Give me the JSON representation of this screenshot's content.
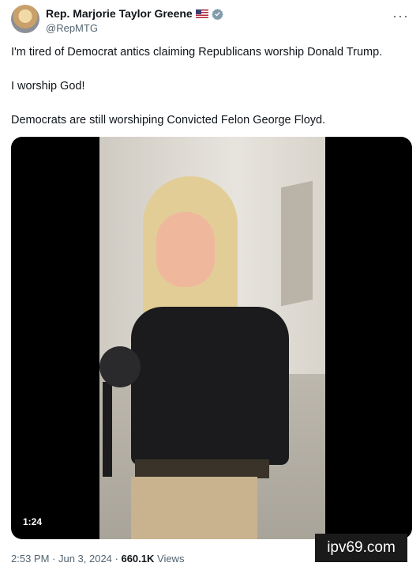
{
  "author": {
    "name": "Rep. Marjorie Taylor Greene",
    "handle": "@RepMTG"
  },
  "tweet": {
    "line1": "I'm tired of Democrat antics claiming Republicans worship Donald Trump.",
    "line2": "I worship God!",
    "line3": "Democrats are still worshiping Convicted Felon George Floyd."
  },
  "video": {
    "duration": "1:24"
  },
  "meta": {
    "time_date": "2:53 PM · Jun 3, 2024 · ",
    "views_count": "660.1K",
    "views_label": " Views"
  },
  "watermark": "ipv69.com",
  "icons": {
    "flag": "us-flag-icon",
    "verified": "verified-badge-icon",
    "more": "more-options-icon"
  },
  "colors": {
    "verified": "#829aab",
    "secondary_text": "#536471"
  }
}
